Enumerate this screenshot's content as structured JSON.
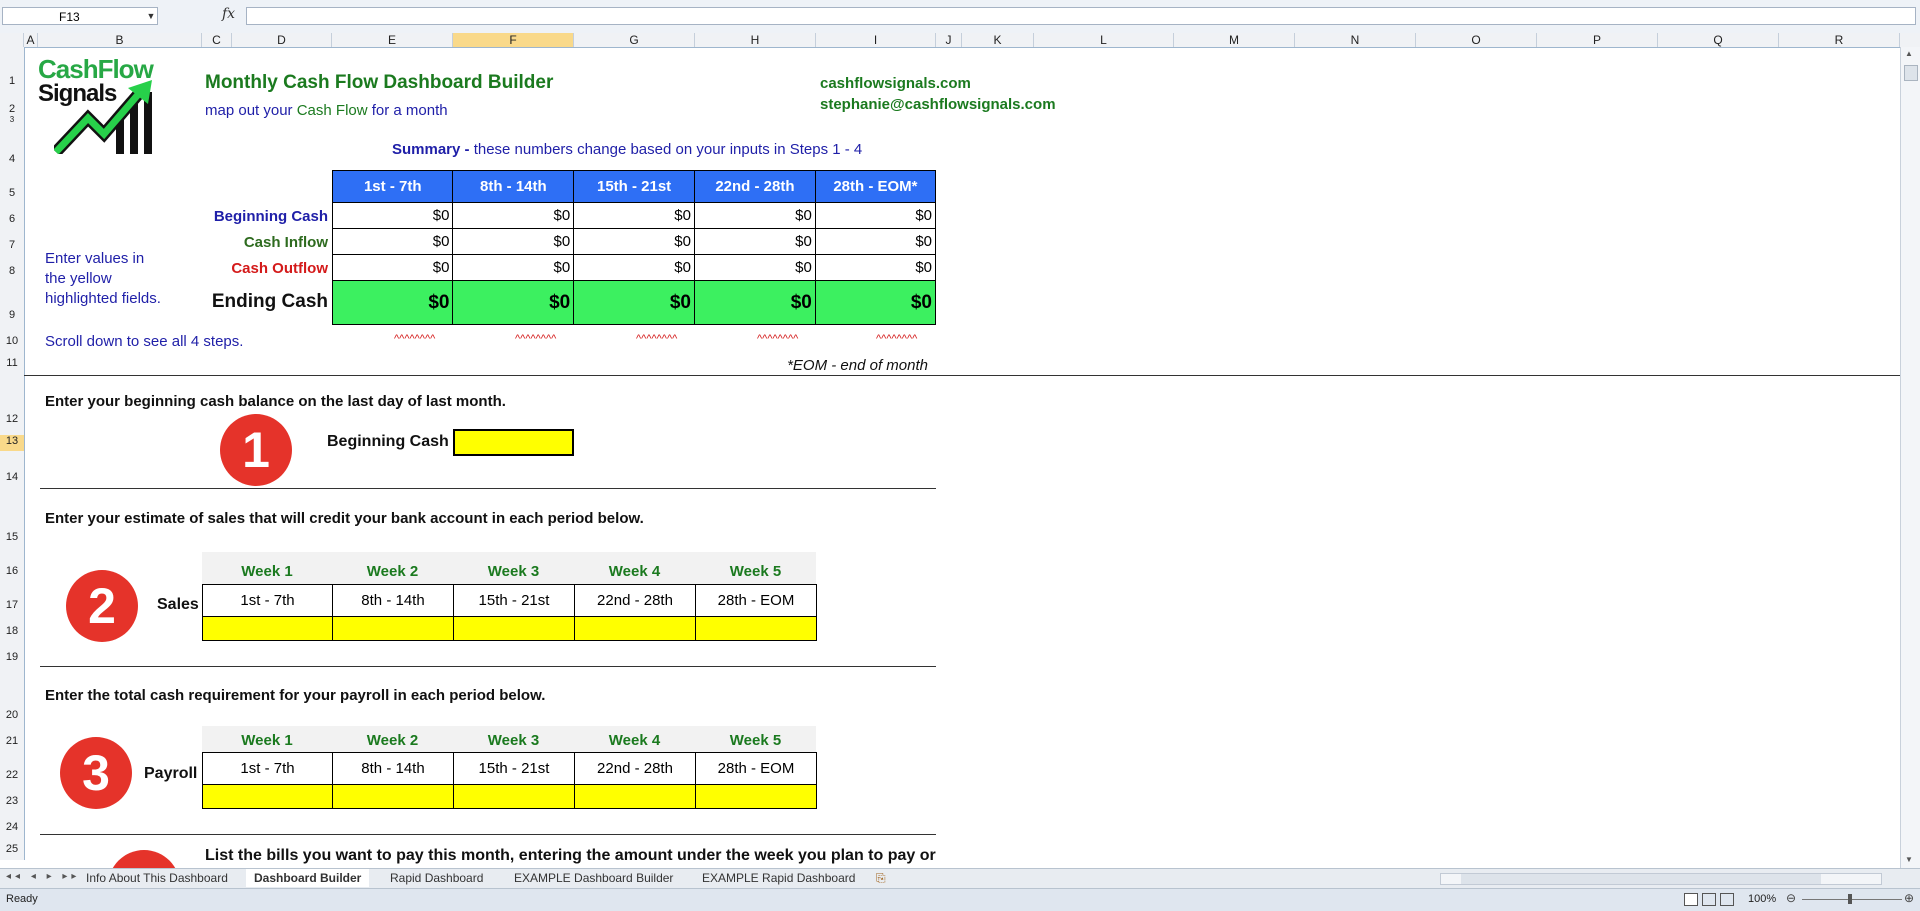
{
  "formula_bar": {
    "name_box": "F13",
    "fx": "fx",
    "formula": ""
  },
  "columns": [
    "A",
    "B",
    "C",
    "D",
    "E",
    "F",
    "G",
    "H",
    "I",
    "J",
    "K",
    "L",
    "M",
    "N",
    "O",
    "P",
    "Q",
    "R"
  ],
  "rows": [
    "1",
    "2",
    "3",
    "4",
    "5",
    "6",
    "7",
    "8",
    "9",
    "10",
    "11",
    "12",
    "13",
    "14",
    "15",
    "16",
    "17",
    "18",
    "19",
    "20",
    "21",
    "22",
    "23",
    "24",
    "25"
  ],
  "logo": {
    "line1": "CashFlow",
    "line2": "Signals"
  },
  "header": {
    "title": "Monthly Cash Flow Dashboard Builder",
    "subtitle_pre": "map out your ",
    "subtitle_mid": "Cash Flow",
    "subtitle_post": " for a month",
    "website": "cashflowsignals.com",
    "email": "stephanie@cashflowsignals.com"
  },
  "summary": {
    "label_bold": "Summary -",
    "label_rest": " these numbers change based on your inputs in Steps 1 - 4",
    "periods": [
      "1st - 7th",
      "8th - 14th",
      "15th - 21st",
      "22nd - 28th",
      "28th - EOM*"
    ],
    "rows": [
      {
        "label": "Beginning Cash",
        "values": [
          "$0",
          "$0",
          "$0",
          "$0",
          "$0"
        ],
        "color": "#1f1fa8"
      },
      {
        "label": "Cash Inflow",
        "values": [
          "$0",
          "$0",
          "$0",
          "$0",
          "$0"
        ],
        "color": "#2e6b1f"
      },
      {
        "label": "Cash Outflow",
        "values": [
          "$0",
          "$0",
          "$0",
          "$0",
          "$0"
        ],
        "color": "#d41a1a"
      }
    ],
    "ending": {
      "label": "Ending Cash",
      "values": [
        "$0",
        "$0",
        "$0",
        "$0",
        "$0"
      ]
    },
    "carets": "^^^^^^^^",
    "eom_note": "*EOM - end of month"
  },
  "side_notes": {
    "line1": "Enter values in",
    "line2": "the yellow",
    "line3": "highlighted fields.",
    "scroll": "Scroll down to see all 4 steps."
  },
  "step1": {
    "number": "1",
    "instruction": "Enter your beginning cash balance on the last day of last month.",
    "label": "Beginning Cash"
  },
  "step2": {
    "number": "2",
    "instruction": "Enter your estimate of sales that will credit your bank account in each period below.",
    "label": "Sales",
    "weeks": [
      "Week 1",
      "Week 2",
      "Week 3",
      "Week 4",
      "Week 5"
    ],
    "periods": [
      "1st - 7th",
      "8th - 14th",
      "15th - 21st",
      "22nd - 28th",
      "28th - EOM"
    ]
  },
  "step3": {
    "number": "3",
    "instruction": "Enter the total cash requirement for your payroll in each period below.",
    "label": "Payroll",
    "weeks": [
      "Week 1",
      "Week 2",
      "Week 3",
      "Week 4",
      "Week 5"
    ],
    "periods": [
      "1st - 7th",
      "8th - 14th",
      "15th - 21st",
      "22nd - 28th",
      "28th - EOM"
    ]
  },
  "step4": {
    "instruction": "List the bills you want to pay this month, entering the amount under the week you plan to pay or"
  },
  "tabs": [
    "Info About This Dashboard",
    "Dashboard Builder",
    "Rapid Dashboard",
    "EXAMPLE Dashboard Builder",
    "EXAMPLE Rapid Dashboard"
  ],
  "status": {
    "ready": "Ready",
    "zoom": "100%"
  },
  "colors": {
    "header_blue": "#2e6ff5",
    "green": "#3cf060",
    "yellow": "#ffff00",
    "step_red": "#e5332a"
  }
}
